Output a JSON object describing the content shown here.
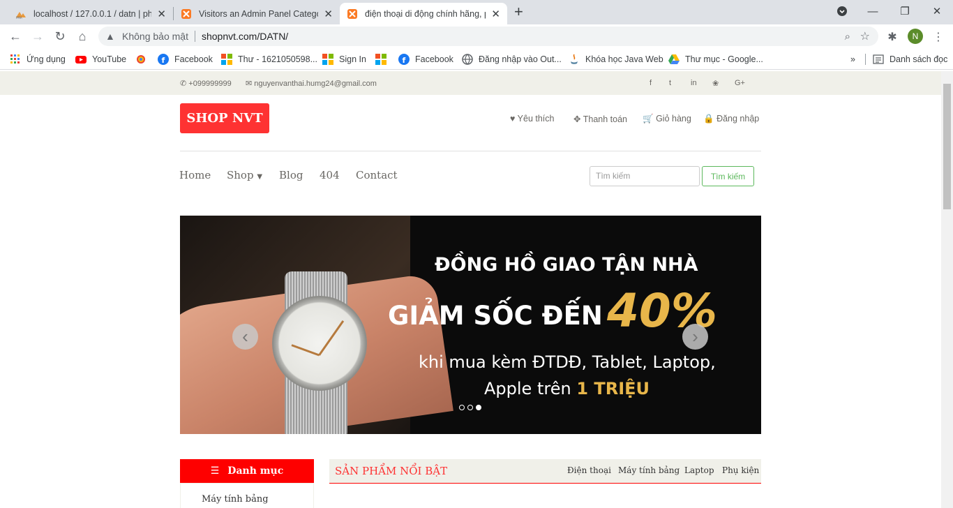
{
  "browser": {
    "tabs": [
      {
        "title": "localhost / 127.0.0.1 / datn | php"
      },
      {
        "title": "Visitors an Admin Panel Category"
      },
      {
        "title": "điện thoại di động chính hãng, p"
      }
    ],
    "address": {
      "security_label": "Không bảo mật",
      "url": "shopnvt.com/DATN/"
    },
    "profile_initial": "N",
    "bookmarks": [
      {
        "label": "Ứng dụng",
        "icon": "apps-grid-icon"
      },
      {
        "label": "YouTube",
        "icon": "youtube-icon"
      },
      {
        "label": "",
        "icon": "colorful-circle-icon"
      },
      {
        "label": "Facebook",
        "icon": "facebook-icon"
      },
      {
        "label": "Thư - 1621050598...",
        "icon": "microsoft-icon"
      },
      {
        "label": "Sign In",
        "icon": "microsoft-icon"
      },
      {
        "label": "Facebook",
        "icon": "facebook-icon"
      },
      {
        "label": "Đăng nhập vào Out...",
        "icon": "globe-icon"
      },
      {
        "label": "Khóa học Java Web",
        "icon": "java-icon"
      },
      {
        "label": "Thư mục - Google...",
        "icon": "google-drive-icon"
      }
    ],
    "bookmarks_overflow": "»",
    "reading_list": "Danh sách đọc"
  },
  "header_top": {
    "phone": "+099999999",
    "email": "nguyenvanthai.humg24@gmail.com",
    "social": [
      "f",
      "t",
      "in",
      "dribbble",
      "G+"
    ]
  },
  "header_middle": {
    "logo": "SHOP NVT",
    "user_menu": [
      {
        "label": "Yêu thích",
        "icon": "heart-icon"
      },
      {
        "label": "Thanh toán",
        "icon": "crosshair-icon"
      },
      {
        "label": "Giỏ hàng",
        "icon": "cart-icon"
      },
      {
        "label": "Đăng nhập",
        "icon": "lock-icon"
      }
    ]
  },
  "main_nav": {
    "items": [
      "Home",
      "Shop",
      "Blog",
      "404",
      "Contact"
    ],
    "search_placeholder": "Tìm kiếm",
    "search_button": "Tìm kiếm"
  },
  "slider": {
    "line1": "ĐỒNG HỒ GIAO TẬN NHÀ",
    "line2": "GIẢM SỐC ĐẾN",
    "discount": "40%",
    "line3": "khi mua kèm ĐTDĐ, Tablet, Laptop,",
    "line4_prefix": "Apple trên",
    "line4_highlight": "1 TRIỆU",
    "active_slide": 3,
    "slide_count": 3
  },
  "category": {
    "title": "Danh mục",
    "items": [
      "Máy tính bảng"
    ]
  },
  "featured": {
    "title": "SẢN PHẨM NỔI BẬT",
    "tabs": [
      "Điện thoại",
      "Máy tính bảng",
      "Laptop",
      "Phụ kiện"
    ]
  },
  "colors": {
    "brand_red": "#fe3232",
    "category_red": "#fe0000",
    "top_bar": "#f0f0e9",
    "search_green": "#5cb85c",
    "discount_gold": "#e8b64a"
  }
}
